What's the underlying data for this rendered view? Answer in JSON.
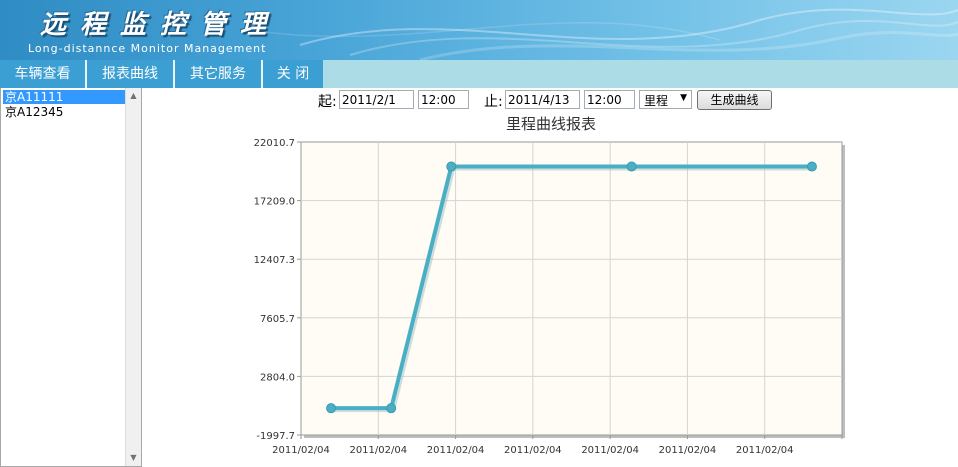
{
  "header": {
    "title": "远程监控管理",
    "subtitle": "Long-distannce Monitor Management"
  },
  "nav": {
    "items": [
      {
        "label": "车辆查看"
      },
      {
        "label": "报表曲线"
      },
      {
        "label": "其它服务"
      },
      {
        "label": "关 闭"
      }
    ]
  },
  "vehicle_list": {
    "items": [
      {
        "label": "京A11111",
        "selected": true
      },
      {
        "label": "京A12345",
        "selected": false
      }
    ]
  },
  "toolbar": {
    "start_label": "起:",
    "start_date": "2011/2/1",
    "start_time": "12:00",
    "end_label": "止:",
    "end_date": "2011/4/13",
    "end_time": "12:00",
    "metric_selected": "里程",
    "generate_label": "生成曲线"
  },
  "colors": {
    "line": "#4aaec4",
    "plot_bg": "#fefcf4",
    "nav_bg": "#3b9fd4",
    "selected_item": "#3399ff"
  },
  "chart_data": {
    "type": "line",
    "title": "里程曲线报表",
    "x": [
      "2011/02/04",
      "2011/02/04",
      "2011/02/04",
      "2011/02/04",
      "2011/02/04",
      "2011/02/04",
      "2011/02/04",
      "2011/02/04",
      "2011/02/04",
      "2011/02/04",
      "2011/02/04",
      "2011/02/04",
      "2011/02/04",
      "2011/02/04",
      "2011/02/04",
      "2011/02/04",
      "2011/02/04",
      "2011/02/04",
      "2011/02/04",
      "2011/02/04",
      "2011/02/04",
      "2011/02/04",
      "2011/02/04",
      "2011/02/04"
    ],
    "x_ticks": [
      "2011/02/04",
      "2011/02/04",
      "2011/02/04",
      "2011/02/04",
      "2011/02/04",
      "2011/02/04",
      "2011/02/04"
    ],
    "series": [
      {
        "points": [
          [
            0,
            200
          ],
          [
            1,
            200
          ],
          [
            2,
            20000
          ],
          [
            5,
            20000
          ],
          [
            8,
            20000
          ]
        ]
      }
    ],
    "y_ticks": [
      22010.7,
      17209.0,
      12407.3,
      7605.7,
      2804.0,
      -1997.7
    ],
    "y_tick_labels": [
      "22010.7",
      "17209.0",
      "12407.3",
      "7605.7",
      "2804.0",
      "-1997.7"
    ],
    "ylim": [
      -1997.7,
      22010.7
    ],
    "xlim": [
      -0.5,
      8.5
    ],
    "grid": true,
    "xlabel": "",
    "ylabel": ""
  }
}
